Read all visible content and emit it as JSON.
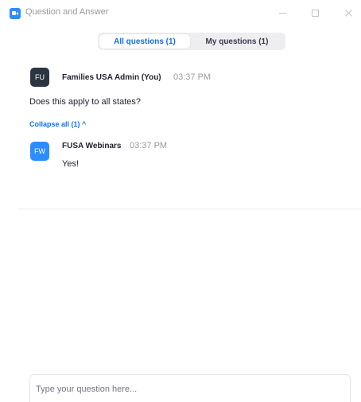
{
  "window": {
    "title": "Question and Answer"
  },
  "tabs": [
    {
      "label": "All questions (1)",
      "active": true
    },
    {
      "label": "My questions (1)",
      "active": false
    }
  ],
  "question": {
    "avatar_initials": "FU",
    "author": "Families USA Admin (You)",
    "time": "03:37 PM",
    "text": "Does this apply to all states?"
  },
  "collapse_label": "Collapse all (1) ^",
  "answer": {
    "avatar_initials": "FW",
    "author": "FUSA Webinars",
    "time": "03:37 PM",
    "text": "Yes!"
  },
  "input": {
    "placeholder": "Type your question here..."
  },
  "colors": {
    "accent": "#0e72ed",
    "app_icon": "#2d8cff",
    "avatar_fu": "#2b3642",
    "avatar_fw": "#2d8cff"
  }
}
